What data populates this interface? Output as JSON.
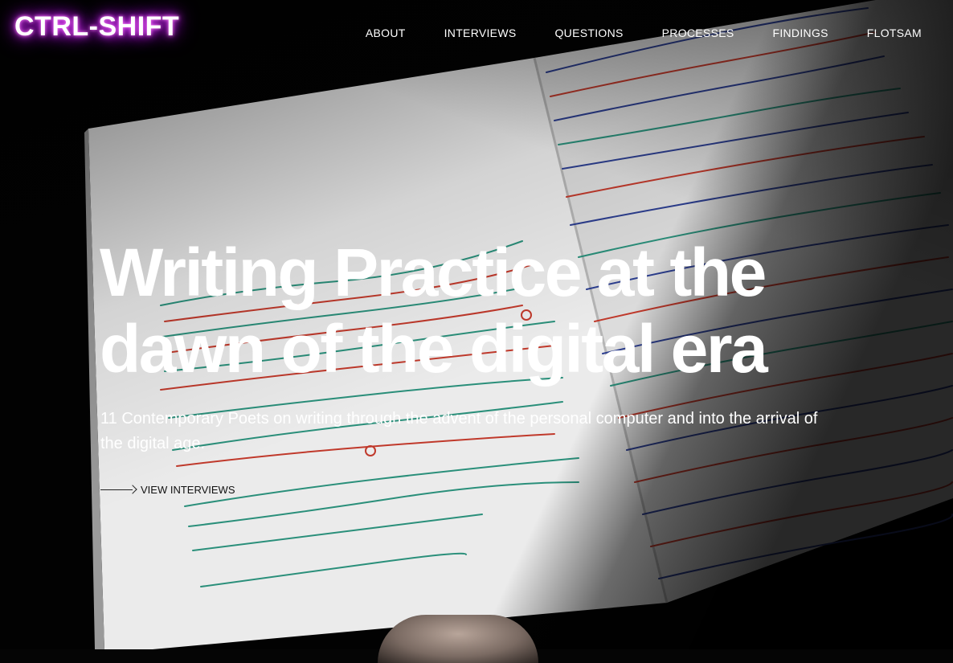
{
  "site": {
    "logo": "CTRL-SHIFT"
  },
  "nav": {
    "items": [
      {
        "label": "ABOUT"
      },
      {
        "label": "INTERVIEWS"
      },
      {
        "label": "QUESTIONS"
      },
      {
        "label": "PROCESSES"
      },
      {
        "label": "FINDINGS"
      },
      {
        "label": "FLOTSAM"
      }
    ]
  },
  "hero": {
    "title": "Writing Practice at the dawn of the digital era",
    "subtitle": "11 Contemporary Poets on writing through the advent of the personal computer and into the arrival of the digital age.",
    "cta_label": "VIEW INTERVIEWS",
    "background": "open notebook with handwritten poem drafts in green, red and blue ink",
    "accent_glow": "#e040fb"
  }
}
